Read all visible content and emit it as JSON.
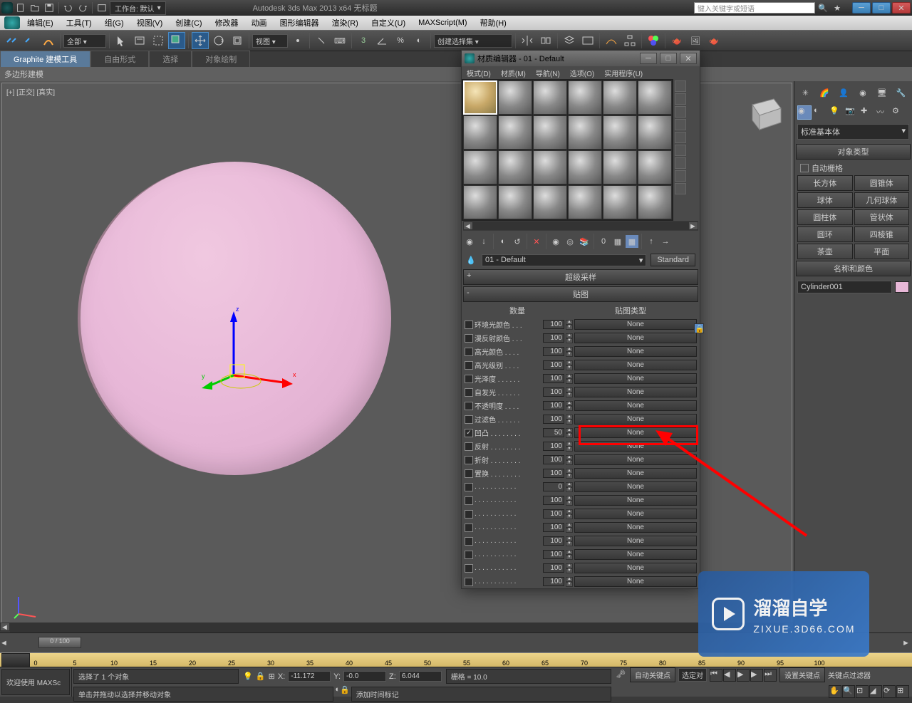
{
  "titlebar": {
    "workspace_label": "工作台: 默认",
    "app_title": "Autodesk 3ds Max  2013 x64    无标题",
    "search_placeholder": "键入关键字或短语"
  },
  "menubar": {
    "items": [
      "编辑(E)",
      "工具(T)",
      "组(G)",
      "视图(V)",
      "创建(C)",
      "修改器",
      "动画",
      "图形编辑器",
      "渲染(R)",
      "自定义(U)",
      "MAXScript(M)",
      "帮助(H)"
    ]
  },
  "maintoolbar": {
    "all_dropdown": "全部",
    "view_dropdown": "视图",
    "selset_dropdown": "创建选择集"
  },
  "ribbon": {
    "tabs": [
      "Graphite 建模工具",
      "自由形式",
      "选择",
      "对象绘制"
    ],
    "sub": "多边形建模"
  },
  "viewport": {
    "label": "[+] [正交] [真实]"
  },
  "right_panel": {
    "dropdown": "标准基本体",
    "section_object_type": "对象类型",
    "auto_grid": "自动栅格",
    "buttons": [
      "长方体",
      "圆锥体",
      "球体",
      "几何球体",
      "圆柱体",
      "管状体",
      "圆环",
      "四棱锥",
      "茶壶",
      "平面"
    ],
    "section_name_color": "名称和颜色",
    "object_name": "Cylinder001"
  },
  "mat_editor": {
    "title": "材质编辑器 - 01 - Default",
    "menu": [
      "模式(D)",
      "材质(M)",
      "导航(N)",
      "选项(O)",
      "实用程序(U)"
    ],
    "material_name": "01 - Default",
    "material_type": "Standard",
    "rollup_supersample": "超级采样",
    "rollup_maps": "贴图",
    "col_amount": "数量",
    "col_maptype": "贴图类型",
    "maps": [
      {
        "enabled": false,
        "label": "环境光颜色 . . .",
        "amount": 100,
        "map": "None"
      },
      {
        "enabled": false,
        "label": "漫反射颜色 . . .",
        "amount": 100,
        "map": "None"
      },
      {
        "enabled": false,
        "label": "高光颜色 . . . .",
        "amount": 100,
        "map": "None"
      },
      {
        "enabled": false,
        "label": "高光级别 . . . .",
        "amount": 100,
        "map": "None"
      },
      {
        "enabled": false,
        "label": "光泽度 . . . . . .",
        "amount": 100,
        "map": "None"
      },
      {
        "enabled": false,
        "label": "自发光 . . . . . .",
        "amount": 100,
        "map": "None"
      },
      {
        "enabled": false,
        "label": "不透明度 . . . .",
        "amount": 100,
        "map": "None"
      },
      {
        "enabled": false,
        "label": "过滤色 . . . . . .",
        "amount": 100,
        "map": "None"
      },
      {
        "enabled": true,
        "label": "凹凸 . . . . . . . .",
        "amount": 50,
        "map": "None"
      },
      {
        "enabled": false,
        "label": "反射 . . . . . . . .",
        "amount": 100,
        "map": "None"
      },
      {
        "enabled": false,
        "label": "折射 . . . . . . . .",
        "amount": 100,
        "map": "None"
      },
      {
        "enabled": false,
        "label": "置换 . . . . . . . .",
        "amount": 100,
        "map": "None"
      },
      {
        "enabled": false,
        "label": ". . . . . . . . . . .",
        "amount": 0,
        "map": "None"
      },
      {
        "enabled": false,
        "label": ". . . . . . . . . . .",
        "amount": 100,
        "map": "None"
      },
      {
        "enabled": false,
        "label": ". . . . . . . . . . .",
        "amount": 100,
        "map": "None"
      },
      {
        "enabled": false,
        "label": ". . . . . . . . . . .",
        "amount": 100,
        "map": "None"
      },
      {
        "enabled": false,
        "label": ". . . . . . . . . . .",
        "amount": 100,
        "map": "None"
      },
      {
        "enabled": false,
        "label": ". . . . . . . . . . .",
        "amount": 100,
        "map": "None"
      },
      {
        "enabled": false,
        "label": ". . . . . . . . . . .",
        "amount": 100,
        "map": "None"
      },
      {
        "enabled": false,
        "label": ". . . . . . . . . . .",
        "amount": 100,
        "map": "None"
      }
    ]
  },
  "timeline": {
    "frame_label": "0 / 100",
    "ticks": [
      0,
      5,
      10,
      15,
      20,
      25,
      30,
      35,
      40,
      45,
      50,
      55,
      60,
      65,
      70,
      75,
      80,
      85,
      90,
      95,
      100
    ]
  },
  "status": {
    "welcome": "欢迎使用  MAXSc",
    "selection": "选择了 1 个对象",
    "prompt": "单击并拖动以选择并移动对象",
    "x_label": "X:",
    "x_value": "-11.172",
    "y_label": "Y:",
    "y_value": "-0.0",
    "z_label": "Z:",
    "z_value": "6.044",
    "grid": "栅格 = 10.0",
    "autokey": "自动关键点",
    "selset": "选定对",
    "add_marker": "添加时间标记",
    "setkey": "设置关键点",
    "keyfilter_label": "关键点过滤器"
  },
  "watermark": {
    "brand": "溜溜自学",
    "url": "ZIXUE.3D66.COM"
  }
}
